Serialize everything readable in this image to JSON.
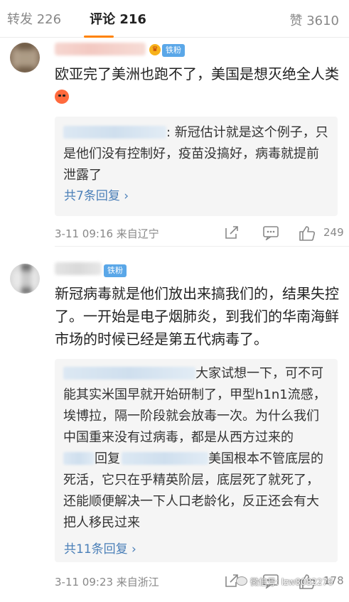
{
  "tabs": {
    "repost": "转发 226",
    "comments": "评论 216",
    "likes": "赞 3610"
  },
  "comments": [
    {
      "badge": "铁粉",
      "text": "欧亚完了美洲也跑不了，美国是想灭绝全人类",
      "reply_text": ": 新冠估计就是这个例子，只是他们没有控制好，疫苗没搞好，病毒就提前泄露了",
      "more": "共7条回复 ›",
      "time": "3-11 09:16  来自辽宁",
      "likes": "249"
    },
    {
      "badge": "铁粉",
      "text": "新冠病毒就是他们放出来搞我们的，结果失控了。一开始是电子烟肺炎，到我们的华南海鲜市场的时候已经是第五代病毒了。",
      "reply1_text": "大家试想一下，可不可能其实米国早就开始研制了，甲型h1n1流感，埃博拉，隔一阶段就会放毒一次。为什么我们中国重来没有过病毒，都是从西方过来的",
      "reply2_prefix": "回复",
      "reply2_text": "美国根本不管底层的死活，它只在乎精英阶层，底层死了就死了，还能顺便解决一下人口老龄化，反正还会有大把人移民过来",
      "more": "共11条回复 ›",
      "time": "3-11 09:23  来自浙江",
      "likes": "178"
    }
  ],
  "watermark": "微信号: lzw8082276"
}
